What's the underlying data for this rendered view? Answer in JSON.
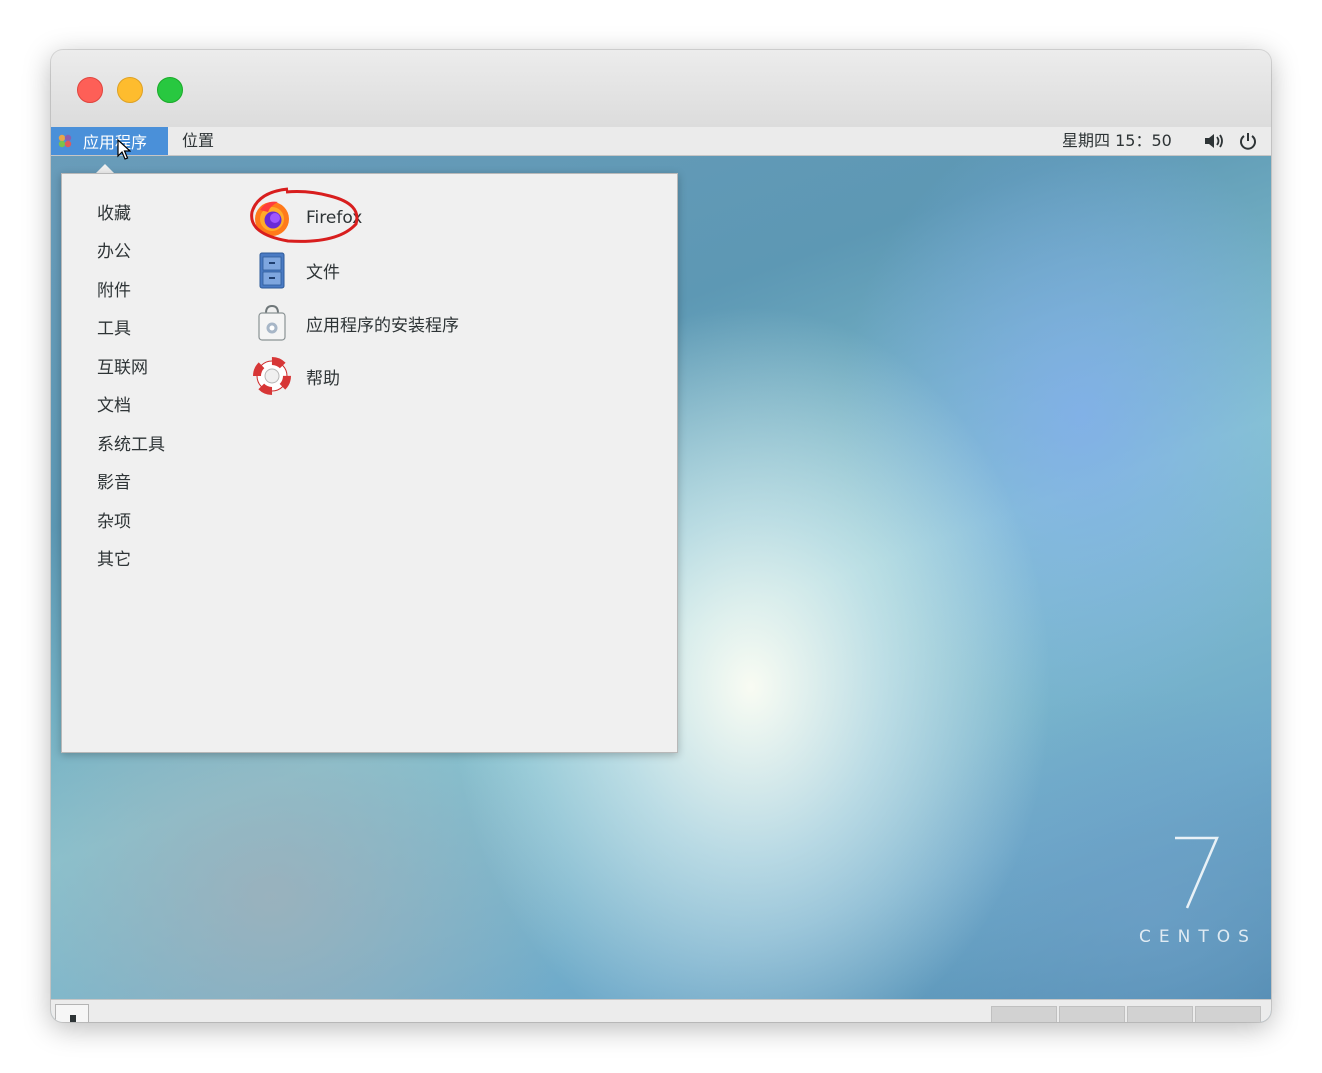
{
  "topbar": {
    "applications_label": "应用程序",
    "places_label": "位置",
    "clock": "星期四 15：50",
    "icons": {
      "logo": "gnome-foot-icon",
      "volume": "speaker-volume-icon",
      "power": "power-icon"
    }
  },
  "menu": {
    "categories": [
      "收藏",
      "办公",
      "附件",
      "工具",
      "互联网",
      "文档",
      "系统工具",
      "影音",
      "杂项",
      "其它"
    ],
    "apps": [
      {
        "label": "Firefox",
        "icon": "firefox-icon"
      },
      {
        "label": "文件",
        "icon": "file-cabinet-icon"
      },
      {
        "label": "应用程序的安装程序",
        "icon": "software-installer-bag-icon"
      },
      {
        "label": "帮助",
        "icon": "lifebuoy-help-icon"
      }
    ]
  },
  "desktop": {
    "brand_number": "7",
    "brand_text": "CENTOS"
  },
  "colors": {
    "accent": "#4a90d9",
    "annotation": "#d81e1e"
  }
}
